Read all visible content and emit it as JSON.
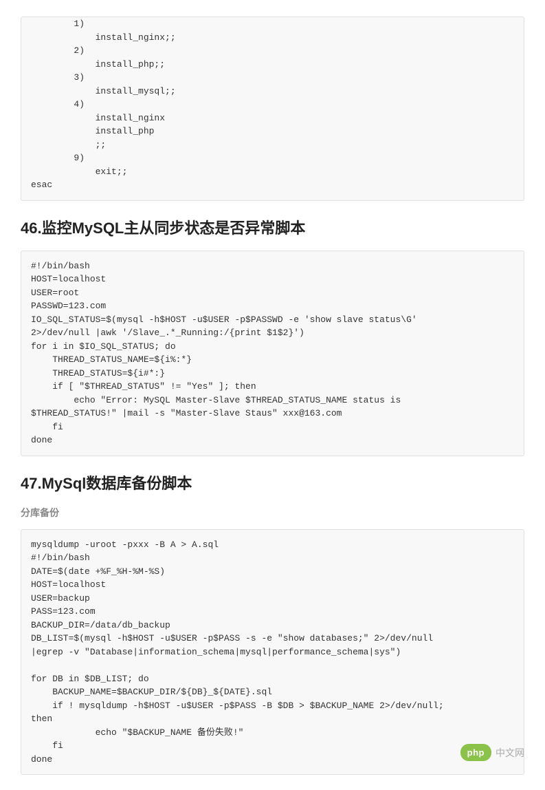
{
  "code_block_1": "        1)\n            install_nginx;;\n        2)\n            install_php;;\n        3)\n            install_mysql;;\n        4)\n            install_nginx\n            install_php\n            ;;\n        9)\n            exit;;\nesac",
  "heading_46": "46.监控MySQL主从同步状态是否异常脚本",
  "code_block_2": "#!/bin/bash\nHOST=localhost\nUSER=root\nPASSWD=123.com\nIO_SQL_STATUS=$(mysql -h$HOST -u$USER -p$PASSWD -e 'show slave status\\G'\n2>/dev/null |awk '/Slave_.*_Running:/{print $1$2}')\nfor i in $IO_SQL_STATUS; do\n    THREAD_STATUS_NAME=${i%:*}\n    THREAD_STATUS=${i#*:}\n    if [ \"$THREAD_STATUS\" != \"Yes\" ]; then\n        echo \"Error: MySQL Master-Slave $THREAD_STATUS_NAME status is\n$THREAD_STATUS!\" |mail -s \"Master-Slave Staus\" xxx@163.com\n    fi\ndone",
  "heading_47": "47.MySql数据库备份脚本",
  "sub_47": "分库备份",
  "code_block_3": "mysqldump -uroot -pxxx -B A > A.sql\n#!/bin/bash\nDATE=$(date +%F_%H-%M-%S)\nHOST=localhost\nUSER=backup\nPASS=123.com\nBACKUP_DIR=/data/db_backup\nDB_LIST=$(mysql -h$HOST -u$USER -p$PASS -s -e \"show databases;\" 2>/dev/null\n|egrep -v \"Database|information_schema|mysql|performance_schema|sys\")\n\nfor DB in $DB_LIST; do\n    BACKUP_NAME=$BACKUP_DIR/${DB}_${DATE}.sql\n    if ! mysqldump -h$HOST -u$USER -p$PASS -B $DB > $BACKUP_NAME 2>/dev/null;\nthen\n            echo \"$BACKUP_NAME 备份失败!\"\n    fi\ndone",
  "watermark_logo": "php",
  "watermark_text": "中文网"
}
